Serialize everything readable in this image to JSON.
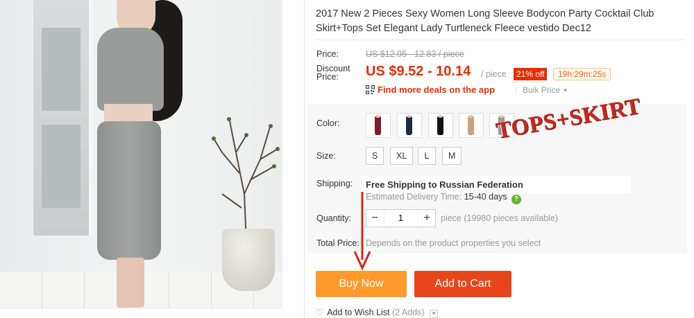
{
  "product": {
    "title": "2017 New 2 Pieces Sexy Women Long Sleeve Bodycon Party Cocktail Club Skirt+Tops Set Elegant Lady Turtleneck Fleece vestido Dec12"
  },
  "price": {
    "label": "Price:",
    "original": "US $12.05 - 12.83 / piece",
    "discount_label": "Discount Price:",
    "discount": "US $9.52 - 10.14",
    "unit": "/ piece",
    "off_badge": "21% off",
    "countdown": "19h:29m:25s",
    "app_deals": "Find more deals on the app",
    "app_deals_icon": "qr-code-icon",
    "bulk_price": "Bulk Price"
  },
  "color": {
    "label": "Color:",
    "swatches": [
      {
        "name": "burgundy",
        "color": "#7a1f2b"
      },
      {
        "name": "navy",
        "color": "#1f2a44"
      },
      {
        "name": "black",
        "color": "#111111"
      },
      {
        "name": "khaki",
        "color": "#c9a27c"
      },
      {
        "name": "gray",
        "color": "#9a9c9b"
      }
    ]
  },
  "size": {
    "label": "Size:",
    "options": [
      "S",
      "XL",
      "L",
      "M"
    ]
  },
  "shipping": {
    "label": "Shipping:",
    "main": "Free Shipping to Russian Federation",
    "estimated_label": "Estimated Delivery Time:",
    "estimated_value": "15-40 days",
    "help_icon": "question-mark-icon"
  },
  "quantity": {
    "label": "Quantity:",
    "minus": "−",
    "value": "1",
    "plus": "+",
    "available": "piece (19980 pieces available)"
  },
  "total": {
    "label": "Total Price:",
    "value": "Depends on the product properties you select"
  },
  "actions": {
    "buy_now": "Buy Now",
    "add_to_cart": "Add to Cart",
    "wishlist": "Add to Wish List",
    "wishlist_count": "(2 Adds)"
  },
  "overlay": {
    "stamp_text": "TOPS+SKIRT",
    "stamp_color": "#c8281e",
    "arrow_color": "#d9241b"
  },
  "colors": {
    "accent_red": "#e62e04",
    "buy_now_bg": "#ff9a2d",
    "add_to_cart_bg": "#e8461a"
  }
}
